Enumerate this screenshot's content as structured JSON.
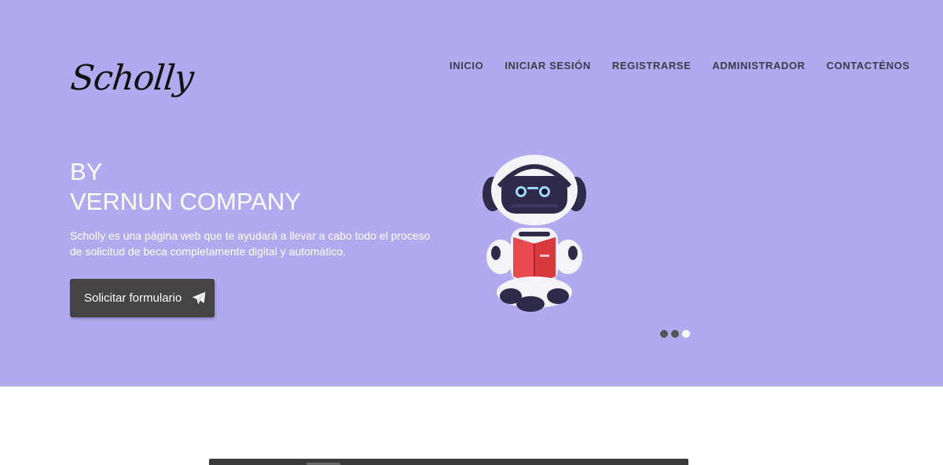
{
  "brand": {
    "logo_text": "Scholly"
  },
  "nav": {
    "items": [
      {
        "label": "INICIO"
      },
      {
        "label": "INICIAR SESIÓN"
      },
      {
        "label": "REGISTRARSE"
      },
      {
        "label": "ADMINISTRADOR"
      },
      {
        "label": "CONTACTÉNOS"
      }
    ]
  },
  "hero": {
    "headline_line1": "BY",
    "headline_line2": "VERNUN COMPANY",
    "description": "Scholly es una página web que te ayudará a llevar a cabo todo el proceso de solicitud de beca completamente digital y automático.",
    "cta_label": "Solicitar formulario",
    "cta_icon": "paper-plane-icon",
    "illustration": "robot-reading-book",
    "carousel": {
      "slides": 3,
      "active_index": 2
    }
  },
  "colors": {
    "hero_bg": "#b1aaef",
    "cta_bg": "#454346",
    "book_red": "#e84a4f"
  }
}
